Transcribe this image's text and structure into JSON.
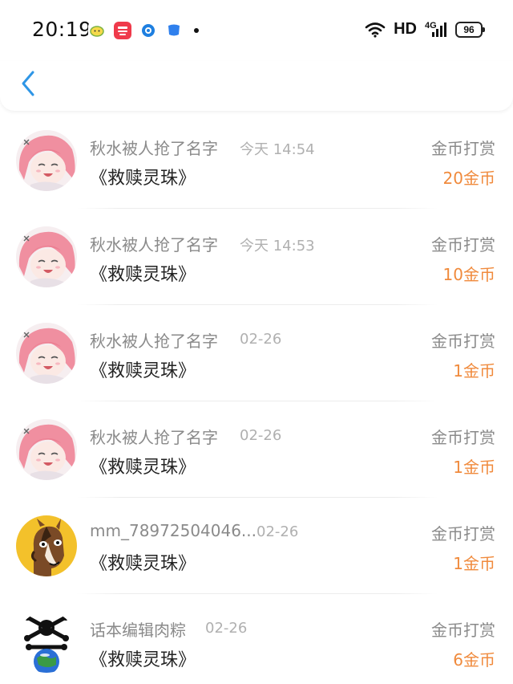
{
  "status_bar": {
    "time": "20:19",
    "network": "HD",
    "signal": "4G",
    "battery": "96"
  },
  "nav": {
    "back_icon": "chevron-left-icon",
    "accent": "#2f96e6"
  },
  "colors": {
    "coin": "#f08a3c",
    "secondary": "#8a8a8a",
    "time": "#b0b0b0",
    "title": "#222222"
  },
  "items": [
    {
      "user": "秋水被人抢了名字",
      "time": "今天 14:54",
      "book": "《救赎灵珠》",
      "reward_type": "金币打赏",
      "amount": "20金币",
      "avatar": "anime-girl"
    },
    {
      "user": "秋水被人抢了名字",
      "time": "今天 14:53",
      "book": "《救赎灵珠》",
      "reward_type": "金币打赏",
      "amount": "10金币",
      "avatar": "anime-girl"
    },
    {
      "user": "秋水被人抢了名字",
      "time": "02-26",
      "book": "《救赎灵珠》",
      "reward_type": "金币打赏",
      "amount": "1金币",
      "avatar": "anime-girl"
    },
    {
      "user": "秋水被人抢了名字",
      "time": "02-26",
      "book": "《救赎灵珠》",
      "reward_type": "金币打赏",
      "amount": "1金币",
      "avatar": "anime-girl"
    },
    {
      "user": "mm_78972504046...",
      "time": "02-26",
      "book": "《救赎灵珠》",
      "reward_type": "金币打赏",
      "amount": "1金币",
      "avatar": "horse"
    },
    {
      "user": "话本编辑肉粽",
      "time": "02-26",
      "book": "《救赎灵珠》",
      "reward_type": "金币打赏",
      "amount": "6金币",
      "avatar": "globe-skull"
    }
  ]
}
